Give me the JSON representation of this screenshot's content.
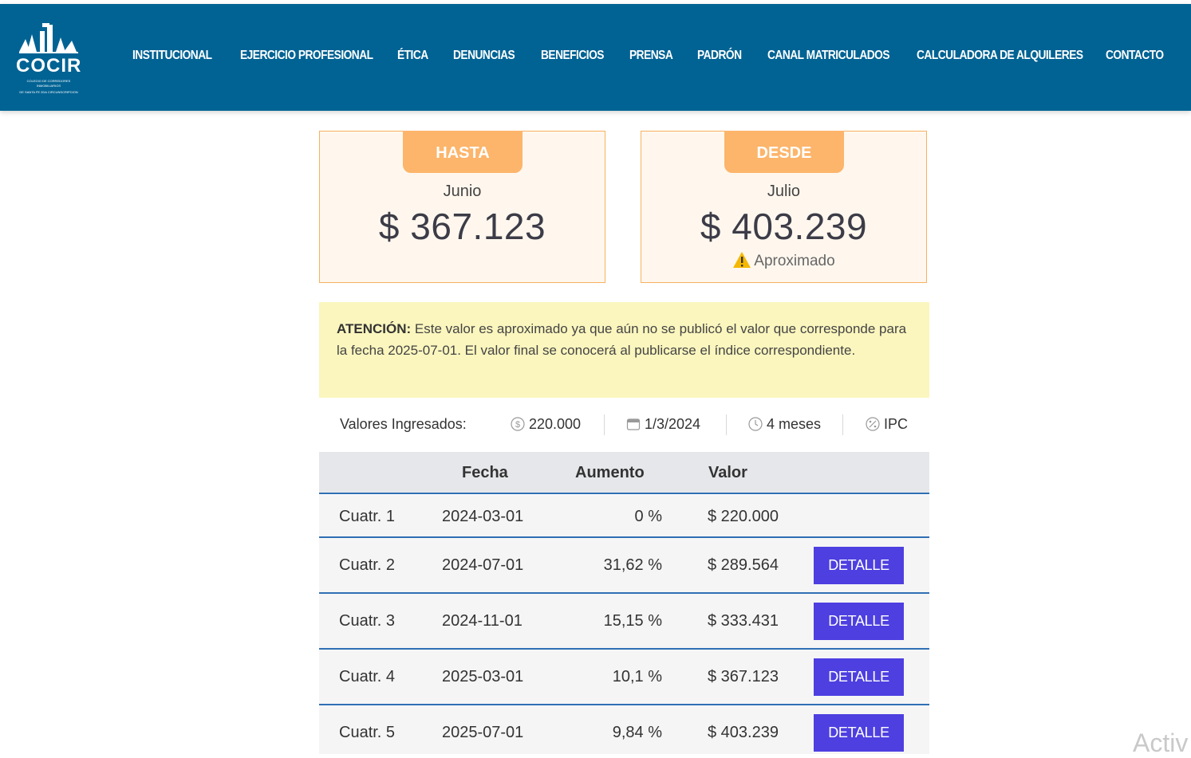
{
  "brand": {
    "name": "COCIR",
    "tagline_1": "COLEGIO DE CORREDORES",
    "tagline_2": "INMOBILIARIOS",
    "tagline_3": "DE SANTA FE 2DA CIRCUNSCRIPCION"
  },
  "nav": [
    "INSTITUCIONAL",
    "EJERCICIO PROFESIONAL",
    "ÉTICA",
    "DENUNCIAS",
    "BENEFICIOS",
    "PRENSA",
    "PADRÓN",
    "CANAL MATRICULADOS",
    "CALCULADORA DE ALQUILERES",
    "CONTACTO"
  ],
  "cards": {
    "hasta": {
      "tab": "HASTA",
      "month": "Junio",
      "amount": "$ 367.123"
    },
    "desde": {
      "tab": "DESDE",
      "month": "Julio",
      "amount": "$ 403.239",
      "note": "Aproximado"
    }
  },
  "alert": {
    "label": "ATENCIÓN:",
    "text": " Este valor es aproximado ya que aún no se publicó el valor que corresponde para la fecha 2025-07-01. El valor final se conocerá al publicarse el índice correspondiente."
  },
  "summary": {
    "label": "Valores Ingresados:",
    "amount": "220.000",
    "date": "1/3/2024",
    "period": "4 meses",
    "index": "IPC"
  },
  "table": {
    "headers": {
      "fecha": "Fecha",
      "aumento": "Aumento",
      "valor": "Valor"
    },
    "detail_label": "DETALLE",
    "rows": [
      {
        "period": "Cuatr. 1",
        "date": "2024-03-01",
        "increase": "0 %",
        "value": "$ 220.000"
      },
      {
        "period": "Cuatr. 2",
        "date": "2024-07-01",
        "increase": "31,62 %",
        "value": "$ 289.564"
      },
      {
        "period": "Cuatr. 3",
        "date": "2024-11-01",
        "increase": "15,15 %",
        "value": "$ 333.431"
      },
      {
        "period": "Cuatr. 4",
        "date": "2025-03-01",
        "increase": "10,1 %",
        "value": "$ 367.123"
      },
      {
        "period": "Cuatr. 5",
        "date": "2025-07-01",
        "increase": "9,84 %",
        "value": "$ 403.239"
      }
    ]
  },
  "watermark": "Activ",
  "colors": {
    "header": "#006394",
    "accent_orange": "#fcb56b",
    "button": "#4d3fe0",
    "alert_bg": "#fbf6be"
  }
}
